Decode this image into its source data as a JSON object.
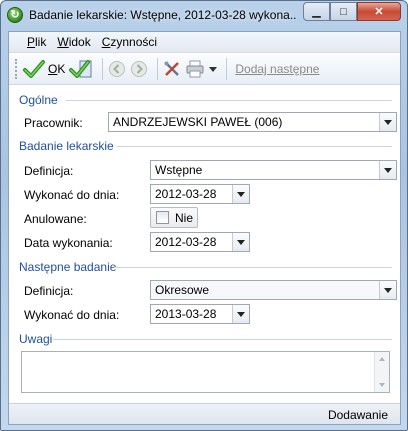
{
  "window": {
    "title": "Badanie lekarskie: Wstępne, 2012-03-28 wykona...",
    "min_glyph": "▁",
    "max_glyph": "□",
    "close_glyph": "✕"
  },
  "menu": {
    "items": [
      {
        "ul": "P",
        "rest": "lik"
      },
      {
        "ul": "W",
        "rest": "idok"
      },
      {
        "ul": "C",
        "rest": "zynności"
      }
    ]
  },
  "toolbar": {
    "ok_label": "OK",
    "add_next_label": "Dodaj następne",
    "icons": [
      "checkmark-icon",
      "checkmark-save-icon",
      "back-icon",
      "forward-icon",
      "tools-icon",
      "printer-icon"
    ]
  },
  "sections": {
    "general": {
      "title": "Ogólne",
      "employee_label": "Pracownik:",
      "employee_value": "ANDRZEJEWSKI PAWEŁ (006)"
    },
    "exam": {
      "title": "Badanie lekarskie",
      "definition_label": "Definicja:",
      "definition_value": "Wstępne",
      "due_label": "Wykonać do dnia:",
      "due_value": "2012-03-28",
      "cancelled_label": "Anulowane:",
      "cancelled_value": "Nie",
      "cancelled_checked": false,
      "done_label": "Data wykonania:",
      "done_value": "2012-03-28"
    },
    "next": {
      "title": "Następne badanie",
      "definition_label": "Definicja:",
      "definition_value": "Okresowe",
      "due_label": "Wykonać do dnia:",
      "due_value": "2013-03-28"
    },
    "notes": {
      "title": "Uwagi",
      "value": ""
    }
  },
  "status": {
    "mode": "Dodawanie"
  },
  "colors": {
    "section_title": "#1f4fa0",
    "ok_green": "#3aa629"
  }
}
